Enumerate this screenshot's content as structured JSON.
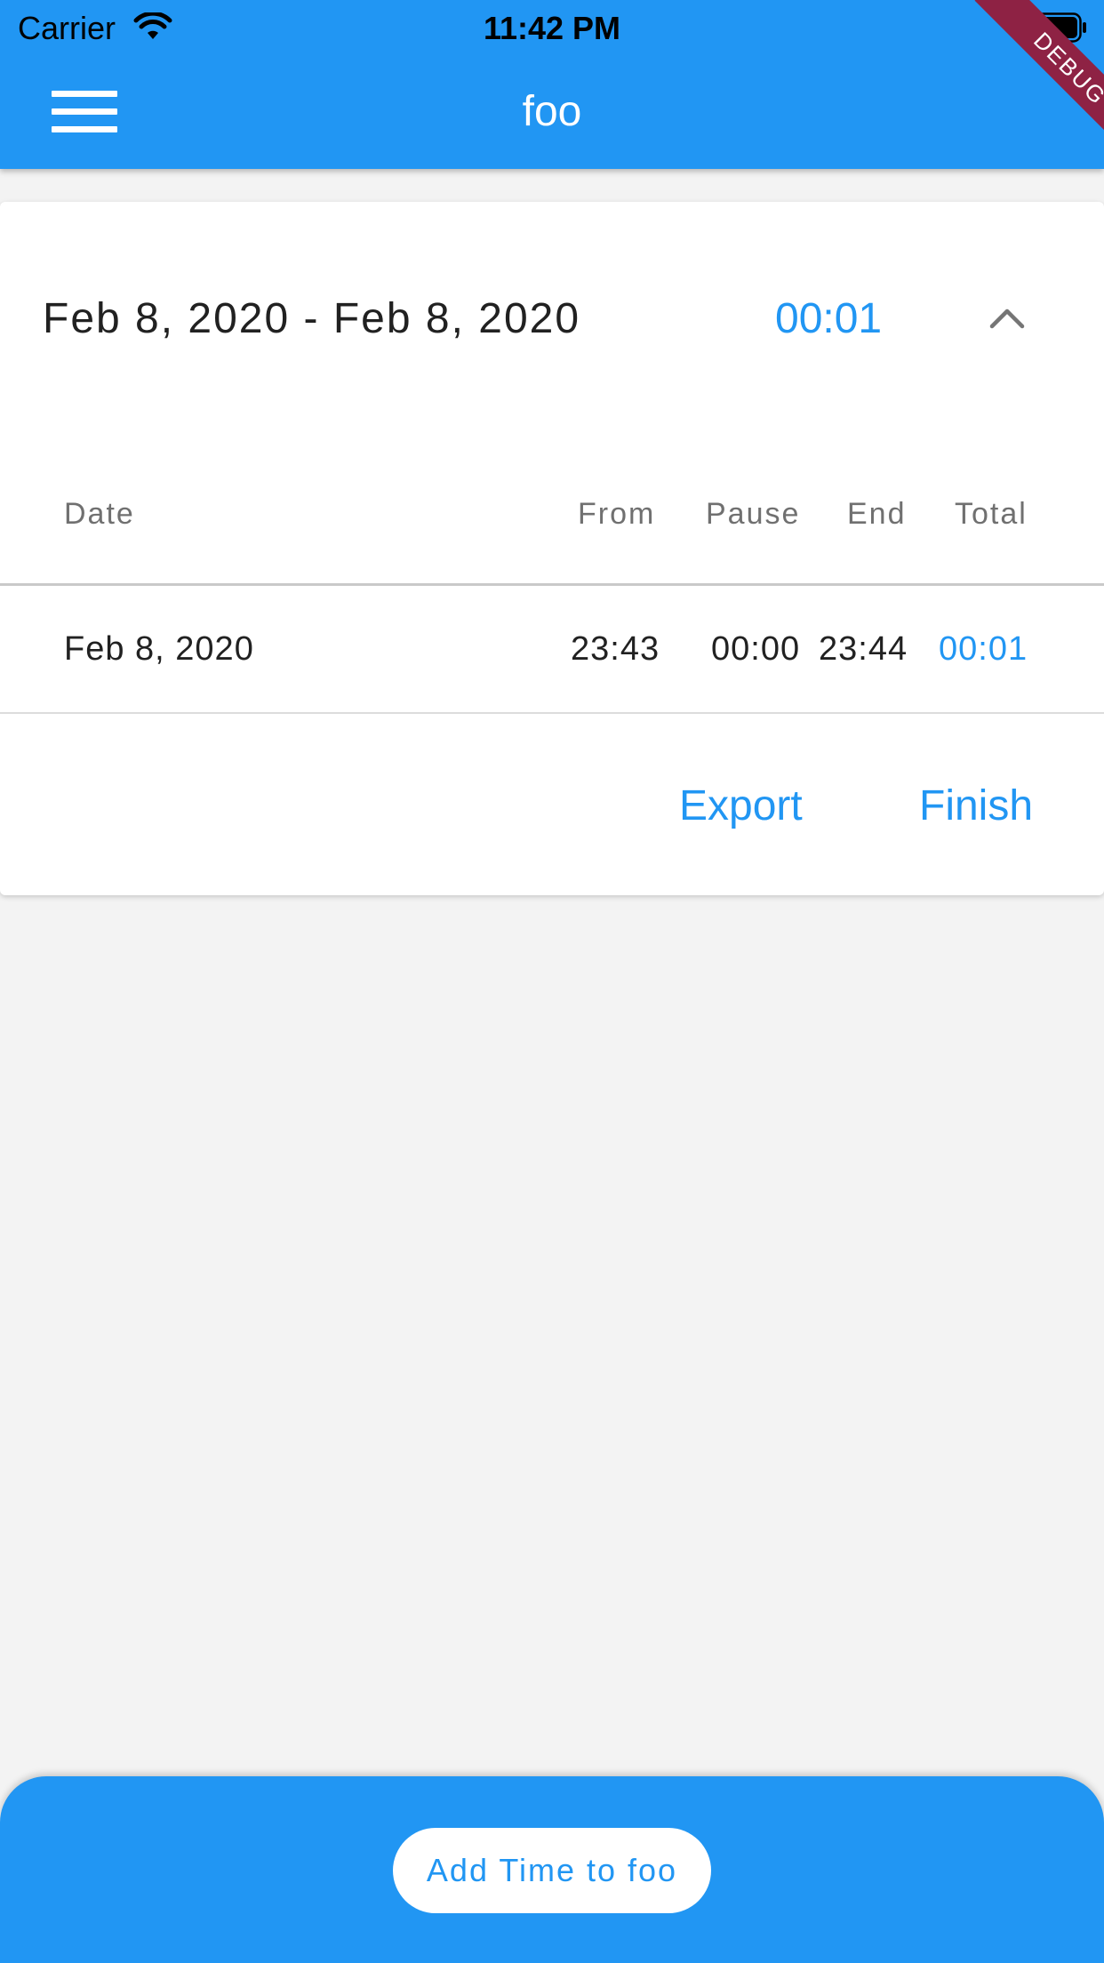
{
  "status_bar": {
    "carrier": "Carrier",
    "time": "11:42 PM",
    "wifi_icon": "wifi-icon",
    "battery_icon": "battery-icon"
  },
  "app_bar": {
    "title": "foo",
    "menu_icon": "hamburger-menu-icon",
    "debug_banner": "DEBUG",
    "background_color": "#2196f3"
  },
  "card": {
    "range_label": "Feb 8, 2020 - Feb 8, 2020",
    "range_total": "00:01",
    "collapse_icon": "chevron-up-icon",
    "columns": {
      "date": "Date",
      "from": "From",
      "pause": "Pause",
      "end": "End",
      "total": "Total"
    },
    "rows": [
      {
        "date": "Feb 8, 2020",
        "from": "23:43",
        "pause": "00:00",
        "end": "23:44",
        "total": "00:01"
      }
    ],
    "actions": {
      "export": "Export",
      "finish": "Finish"
    }
  },
  "bottom_bar": {
    "add_button_label": "Add Time to foo"
  },
  "colors": {
    "accent": "#2196f3",
    "background": "#f3f3f3",
    "debug_ribbon": "#8e2244"
  }
}
